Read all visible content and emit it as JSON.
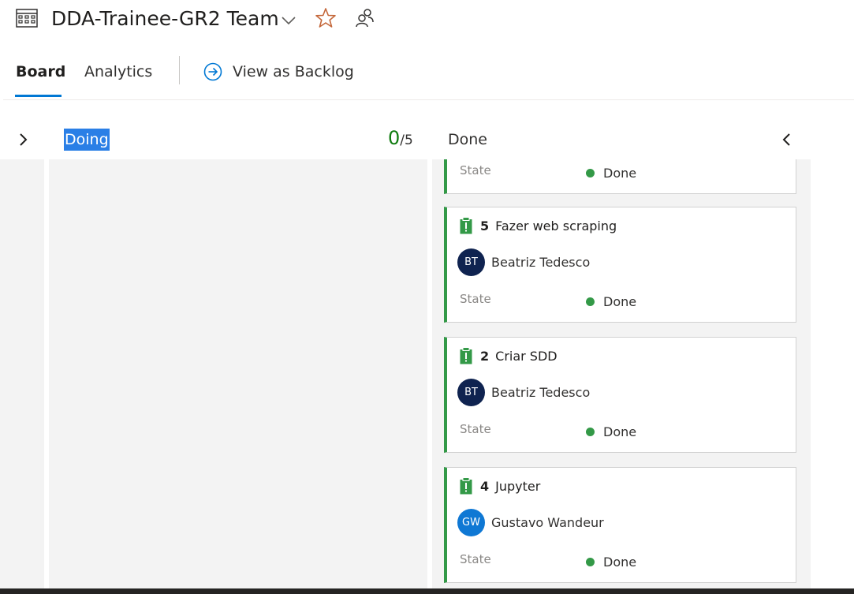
{
  "header": {
    "team_name": "DDA-Trainee-GR2 Team",
    "icons": {
      "board": "board-grid-icon",
      "dropdown": "chevron-down-icon",
      "favorite": "star-outline-icon",
      "members": "people-icon"
    }
  },
  "tabs": {
    "board": "Board",
    "analytics": "Analytics",
    "view_backlog": "View as Backlog",
    "view_backlog_icon": "arrow-right-circle-icon"
  },
  "columns": {
    "doing": {
      "title": "Doing",
      "wip_current": "0",
      "wip_limit": "/5"
    },
    "done": {
      "title": "Done"
    }
  },
  "cards": [
    {
      "state_label": "State",
      "state": "Done"
    },
    {
      "id": "5",
      "title": "Fazer web scraping",
      "assignee_initials": "BT",
      "assignee": "Beatriz Tedesco",
      "state_label": "State",
      "state": "Done"
    },
    {
      "id": "2",
      "title": "Criar SDD",
      "assignee_initials": "BT",
      "assignee": "Beatriz Tedesco",
      "state_label": "State",
      "state": "Done"
    },
    {
      "id": "4",
      "title": "Jupyter",
      "assignee_initials": "GW",
      "assignee": "Gustavo Wandeur",
      "state_label": "State",
      "state": "Done"
    }
  ],
  "colors": {
    "accent": "#0078d4",
    "card_border": "#339947",
    "state_done": "#339947",
    "avatar_bt": "#0f2350",
    "avatar_gw": "#0f78d4",
    "wip_ok": "#107c10",
    "favorite_star": "#c4673a"
  }
}
